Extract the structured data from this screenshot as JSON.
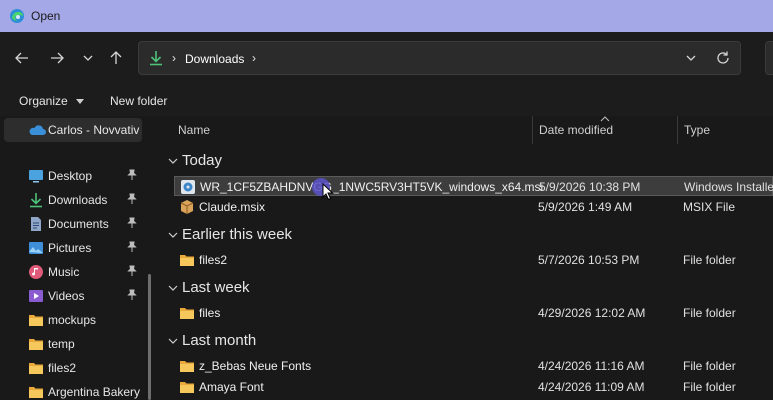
{
  "window": {
    "title": "Open"
  },
  "nav": {
    "back": "back-arrow-icon",
    "forward": "forward-arrow-icon",
    "recent": "chevron-down-icon",
    "up": "up-arrow-icon"
  },
  "address": {
    "location_icon": "download-icon",
    "crumb": "Downloads"
  },
  "commands": {
    "organize": "Organize",
    "new_folder": "New folder"
  },
  "sidebar": {
    "onedrive": "Carlos - Novvativ",
    "items": [
      {
        "label": "Desktop",
        "icon": "desktop-icon",
        "pinned": true
      },
      {
        "label": "Downloads",
        "icon": "download-icon",
        "pinned": true
      },
      {
        "label": "Documents",
        "icon": "documents-icon",
        "pinned": true
      },
      {
        "label": "Pictures",
        "icon": "pictures-icon",
        "pinned": true
      },
      {
        "label": "Music",
        "icon": "music-icon",
        "pinned": true
      },
      {
        "label": "Videos",
        "icon": "videos-icon",
        "pinned": true
      },
      {
        "label": "mockups",
        "icon": "folder-icon",
        "pinned": false
      },
      {
        "label": "temp",
        "icon": "folder-icon",
        "pinned": false
      },
      {
        "label": "files2",
        "icon": "folder-icon",
        "pinned": false
      },
      {
        "label": "Argentina Bakery",
        "icon": "folder-icon",
        "pinned": false
      }
    ]
  },
  "columns": {
    "name": "Name",
    "date": "Date modified",
    "type": "Type"
  },
  "groups": {
    "today": "Today",
    "earlier": "Earlier this week",
    "lastweek": "Last week",
    "lastmonth": "Last month"
  },
  "files": {
    "msi": {
      "name": "WR_1CF5ZBAHDNVGG_1NWC5RV3HT5VK_windows_x64.msi",
      "date": "5/9/2026 10:38 PM",
      "type": "Windows Installer"
    },
    "msix": {
      "name": "Claude.msix",
      "date": "5/9/2026 1:49 AM",
      "type": "MSIX File"
    },
    "files2": {
      "name": "files2",
      "date": "5/7/2026 10:53 PM",
      "type": "File folder"
    },
    "files": {
      "name": "files",
      "date": "4/29/2026 12:02 AM",
      "type": "File folder"
    },
    "bebas": {
      "name": "z_Bebas Neue Fonts",
      "date": "4/24/2026 11:16 AM",
      "type": "File folder"
    },
    "amaya": {
      "name": "Amaya Font",
      "date": "4/24/2026 11:09 AM",
      "type": "File folder"
    }
  },
  "colors": {
    "titlebar": "#a5a8e6",
    "background": "#191919",
    "folder": "#f2c14e",
    "accent_green": "#4cc27a",
    "cursor_highlight": "#5b52c9"
  }
}
